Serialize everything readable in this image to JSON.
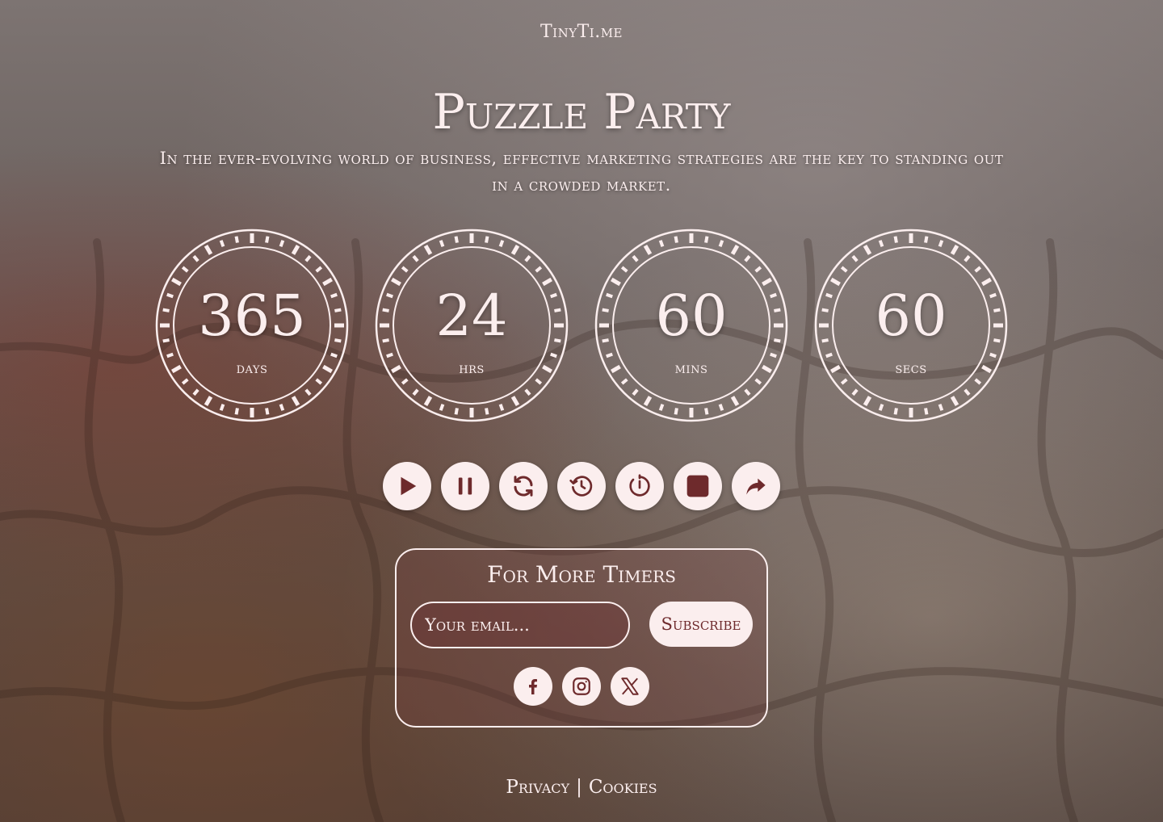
{
  "site": {
    "name": "TinyTi.me"
  },
  "hero": {
    "title": "Puzzle Party",
    "subtitle": "In the ever-evolving world of business, effective marketing strategies are the key to standing out in a crowded market."
  },
  "countdown": [
    {
      "value": "365",
      "label": "days"
    },
    {
      "value": "24",
      "label": "hrs"
    },
    {
      "value": "60",
      "label": "mins"
    },
    {
      "value": "60",
      "label": "secs"
    }
  ],
  "controls": [
    "play-icon",
    "pause-icon",
    "refresh-icon",
    "history-icon",
    "timer-icon",
    "stop-icon",
    "share-icon"
  ],
  "subscribe": {
    "title": "For More Timers",
    "email_placeholder": "Your email...",
    "button_label": "Subscribe"
  },
  "social": [
    "facebook-icon",
    "instagram-icon",
    "x-icon"
  ],
  "footer": {
    "privacy": "Privacy",
    "separator": "|",
    "cookies": "Cookies"
  },
  "colors": {
    "accent": "#6e2a2c",
    "text": "#fbeeee"
  }
}
